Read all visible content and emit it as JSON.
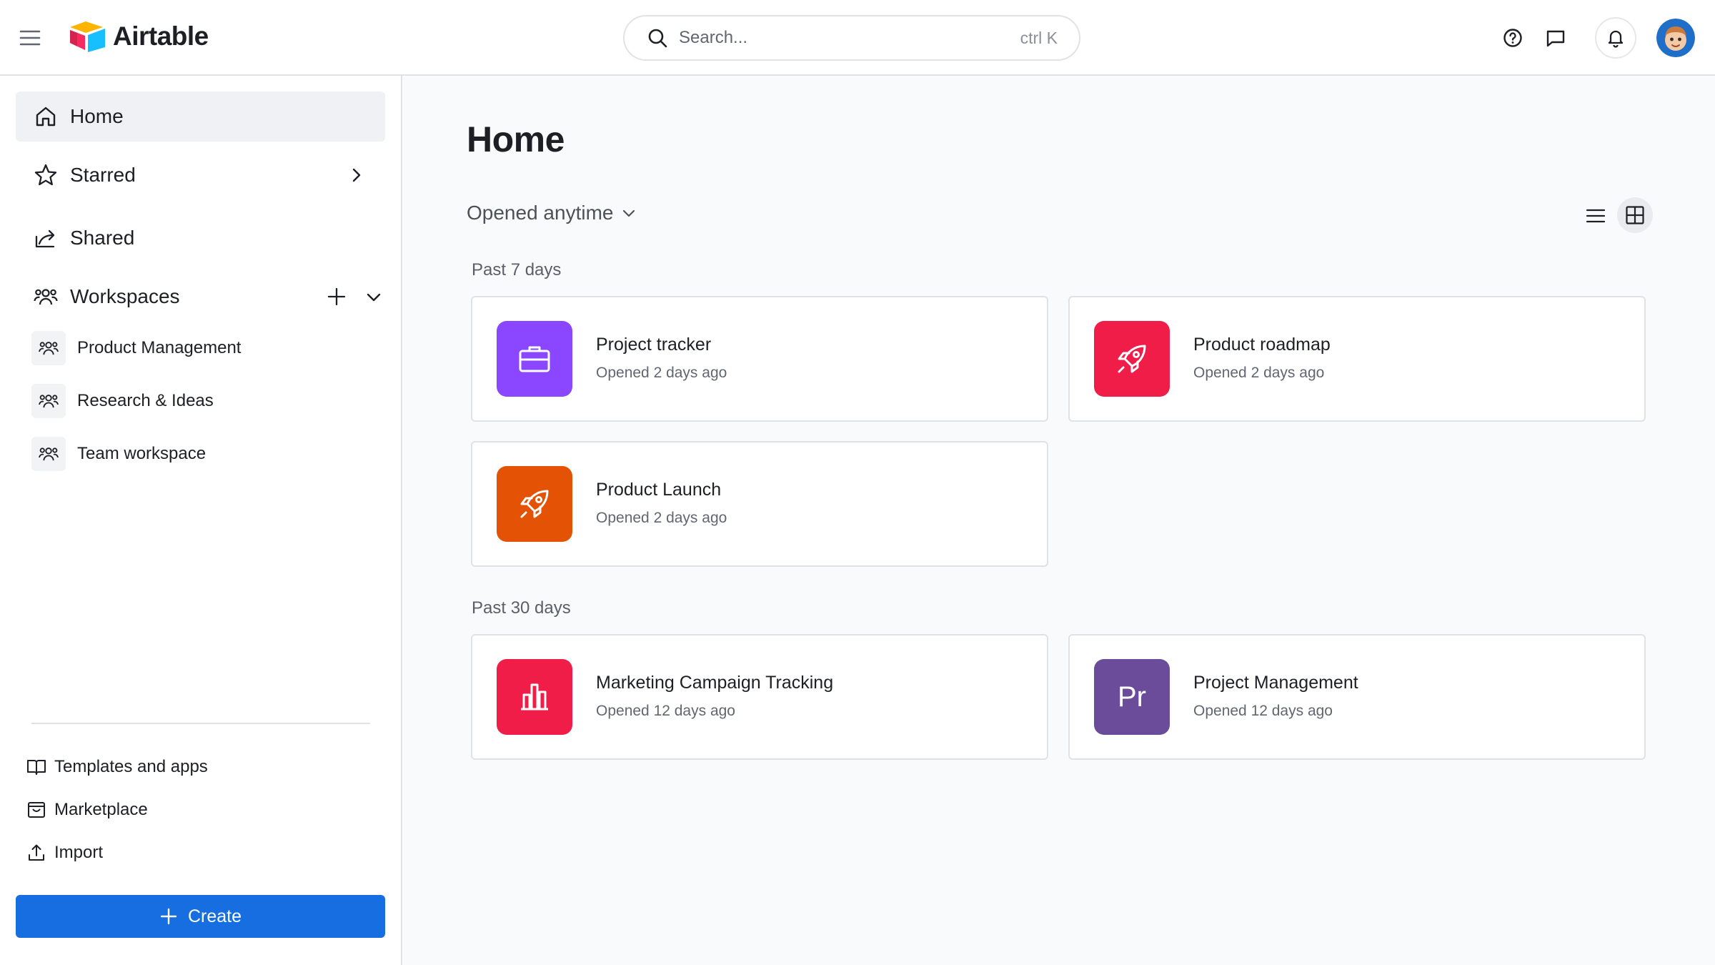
{
  "app": {
    "name": "Airtable"
  },
  "search": {
    "placeholder": "Search...",
    "shortcut": "ctrl K"
  },
  "sidebar": {
    "nav": [
      {
        "label": "Home"
      },
      {
        "label": "Starred"
      },
      {
        "label": "Shared"
      },
      {
        "label": "Workspaces"
      }
    ],
    "workspaces": [
      {
        "label": "Product Management"
      },
      {
        "label": "Research & Ideas"
      },
      {
        "label": "Team workspace"
      }
    ],
    "footer": [
      {
        "label": "Templates and apps",
        "icon": "book-icon"
      },
      {
        "label": "Marketplace",
        "icon": "marketplace-icon"
      },
      {
        "label": "Import",
        "icon": "upload-icon"
      }
    ],
    "create_label": "Create"
  },
  "main": {
    "title": "Home",
    "filter_label": "Opened anytime",
    "sections": [
      {
        "label": "Past 7 days",
        "cards": [
          {
            "title": "Project tracker",
            "subtitle": "Opened 2 days ago",
            "color": "#8b46ff",
            "icon": "briefcase-icon"
          },
          {
            "title": "Product roadmap",
            "subtitle": "Opened 2 days ago",
            "color": "#ef1d48",
            "icon": "rocket-icon"
          },
          {
            "title": "Product Launch",
            "subtitle": "Opened 2 days ago",
            "color": "#e45206",
            "icon": "rocket-icon"
          }
        ]
      },
      {
        "label": "Past 30 days",
        "cards": [
          {
            "title": "Marketing Campaign Tracking",
            "subtitle": "Opened 12 days ago",
            "color": "#ef1d48",
            "icon": "bar-chart-icon"
          },
          {
            "title": "Project Management",
            "subtitle": "Opened 12 days ago",
            "color": "#6b4c9a",
            "icon": "text-initials",
            "initials": "Pr"
          }
        ]
      }
    ]
  },
  "colors": {
    "accent": "#166ee1",
    "sidebar_active": "#f0f1f4",
    "main_bg": "#f9fafc"
  }
}
